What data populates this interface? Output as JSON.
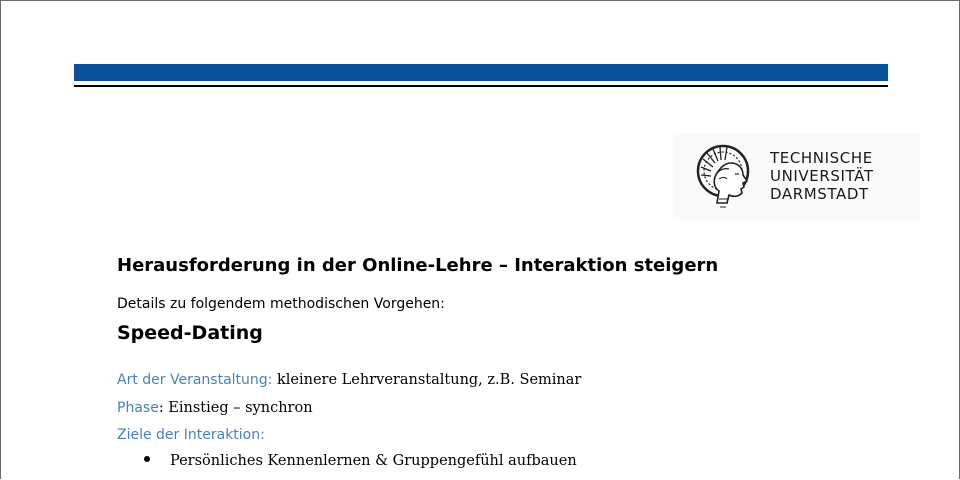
{
  "logo": {
    "emblem_icon": "athena-head-emblem",
    "lines": [
      "TECHNISCHE",
      "UNIVERSITÄT",
      "DARMSTADT"
    ]
  },
  "heading": "Herausforderung in der Online-Lehre – Interaktion steigern",
  "subheading": "Details zu folgendem methodischen Vorgehen:",
  "method_title": "Speed-Dating",
  "fields": {
    "art": {
      "label": "Art der Veranstaltung:",
      "value": " kleinere Lehrveranstaltung, z.B. Seminar"
    },
    "phase": {
      "label": "Phase",
      "value": ": Einstieg – synchron"
    },
    "ziele": {
      "label": "Ziele der Interaktion:"
    }
  },
  "bullets": [
    "Persönliches Kennenlernen & Gruppengefühl aufbauen"
  ],
  "colors": {
    "band": "#0a5297",
    "label_blue": "#4a7fbf"
  }
}
